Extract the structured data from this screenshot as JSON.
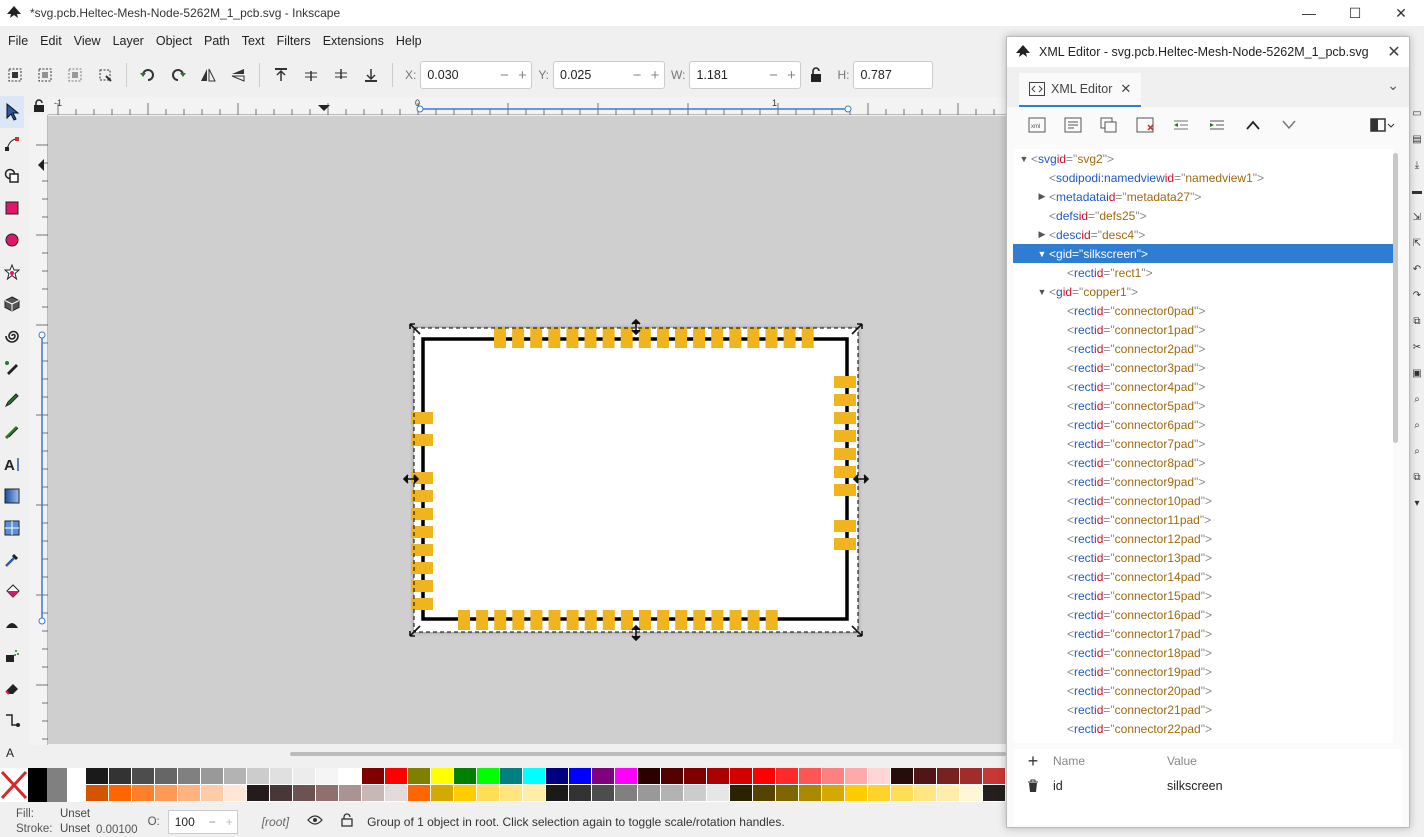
{
  "window": {
    "title": "*svg.pcb.Heltec-Mesh-Node-5262M_1_pcb.svg - Inkscape",
    "minimize": "—",
    "maximize": "☐",
    "close": "✕"
  },
  "menu": [
    "File",
    "Edit",
    "View",
    "Layer",
    "Object",
    "Path",
    "Text",
    "Filters",
    "Extensions",
    "Help"
  ],
  "toolbar": {
    "x_label": "X:",
    "x_value": "0.030",
    "y_label": "Y:",
    "y_value": "0.025",
    "w_label": "W:",
    "w_value": "1.181",
    "h_label": "H:",
    "h_value": "0.787"
  },
  "ruler": {
    "h_labels": [
      "-1",
      "0",
      "1"
    ]
  },
  "xml_editor": {
    "panel_title": "XML Editor - svg.pcb.Heltec-Mesh-Node-5262M_1_pcb.svg",
    "tab_label": "XML Editor",
    "tree": [
      {
        "indent": 0,
        "tri": "open",
        "tag": "svg",
        "attr": "id",
        "val": "svg2",
        "sel": false
      },
      {
        "indent": 1,
        "tri": "none",
        "tag": "sodipodi:namedview",
        "attr": "id",
        "val": "namedview1",
        "sel": false
      },
      {
        "indent": 1,
        "tri": "closed",
        "tag": "metadata",
        "attr": "id",
        "val": "metadata27",
        "sel": false
      },
      {
        "indent": 1,
        "tri": "none",
        "tag": "defs",
        "attr": "id",
        "val": "defs25",
        "sel": false
      },
      {
        "indent": 1,
        "tri": "closed",
        "tag": "desc",
        "attr": "id",
        "val": "desc4",
        "sel": false
      },
      {
        "indent": 1,
        "tri": "open",
        "tag": "g",
        "attr": "id",
        "val": "silkscreen",
        "sel": true
      },
      {
        "indent": 2,
        "tri": "none",
        "tag": "rect",
        "attr": "id",
        "val": "rect1",
        "sel": false
      },
      {
        "indent": 1,
        "tri": "open",
        "tag": "g",
        "attr": "id",
        "val": "copper1",
        "sel": false
      },
      {
        "indent": 2,
        "tri": "none",
        "tag": "rect",
        "attr": "id",
        "val": "connector0pad",
        "sel": false
      },
      {
        "indent": 2,
        "tri": "none",
        "tag": "rect",
        "attr": "id",
        "val": "connector1pad",
        "sel": false
      },
      {
        "indent": 2,
        "tri": "none",
        "tag": "rect",
        "attr": "id",
        "val": "connector2pad",
        "sel": false
      },
      {
        "indent": 2,
        "tri": "none",
        "tag": "rect",
        "attr": "id",
        "val": "connector3pad",
        "sel": false
      },
      {
        "indent": 2,
        "tri": "none",
        "tag": "rect",
        "attr": "id",
        "val": "connector4pad",
        "sel": false
      },
      {
        "indent": 2,
        "tri": "none",
        "tag": "rect",
        "attr": "id",
        "val": "connector5pad",
        "sel": false
      },
      {
        "indent": 2,
        "tri": "none",
        "tag": "rect",
        "attr": "id",
        "val": "connector6pad",
        "sel": false
      },
      {
        "indent": 2,
        "tri": "none",
        "tag": "rect",
        "attr": "id",
        "val": "connector7pad",
        "sel": false
      },
      {
        "indent": 2,
        "tri": "none",
        "tag": "rect",
        "attr": "id",
        "val": "connector8pad",
        "sel": false
      },
      {
        "indent": 2,
        "tri": "none",
        "tag": "rect",
        "attr": "id",
        "val": "connector9pad",
        "sel": false
      },
      {
        "indent": 2,
        "tri": "none",
        "tag": "rect",
        "attr": "id",
        "val": "connector10pad",
        "sel": false
      },
      {
        "indent": 2,
        "tri": "none",
        "tag": "rect",
        "attr": "id",
        "val": "connector11pad",
        "sel": false
      },
      {
        "indent": 2,
        "tri": "none",
        "tag": "rect",
        "attr": "id",
        "val": "connector12pad",
        "sel": false
      },
      {
        "indent": 2,
        "tri": "none",
        "tag": "rect",
        "attr": "id",
        "val": "connector13pad",
        "sel": false
      },
      {
        "indent": 2,
        "tri": "none",
        "tag": "rect",
        "attr": "id",
        "val": "connector14pad",
        "sel": false
      },
      {
        "indent": 2,
        "tri": "none",
        "tag": "rect",
        "attr": "id",
        "val": "connector15pad",
        "sel": false
      },
      {
        "indent": 2,
        "tri": "none",
        "tag": "rect",
        "attr": "id",
        "val": "connector16pad",
        "sel": false
      },
      {
        "indent": 2,
        "tri": "none",
        "tag": "rect",
        "attr": "id",
        "val": "connector17pad",
        "sel": false
      },
      {
        "indent": 2,
        "tri": "none",
        "tag": "rect",
        "attr": "id",
        "val": "connector18pad",
        "sel": false
      },
      {
        "indent": 2,
        "tri": "none",
        "tag": "rect",
        "attr": "id",
        "val": "connector19pad",
        "sel": false
      },
      {
        "indent": 2,
        "tri": "none",
        "tag": "rect",
        "attr": "id",
        "val": "connector20pad",
        "sel": false
      },
      {
        "indent": 2,
        "tri": "none",
        "tag": "rect",
        "attr": "id",
        "val": "connector21pad",
        "sel": false
      },
      {
        "indent": 2,
        "tri": "none",
        "tag": "rect",
        "attr": "id",
        "val": "connector22pad",
        "sel": false
      }
    ],
    "attr_header": {
      "name": "Name",
      "value": "Value"
    },
    "attributes": [
      {
        "name": "id",
        "value": "silkscreen"
      }
    ]
  },
  "status": {
    "fill_label": "Fill:",
    "fill_value": "Unset",
    "stroke_label": "Stroke:",
    "stroke_value": "Unset",
    "stroke_width": "0.00100",
    "opacity_label": "O:",
    "opacity_value": "100",
    "layer": "[root]",
    "message": "Group of 1 object in root. Click selection again to toggle scale/rotation handles."
  },
  "colors": {
    "accent": "#2f7cd3",
    "pad": "#f0b41e"
  }
}
